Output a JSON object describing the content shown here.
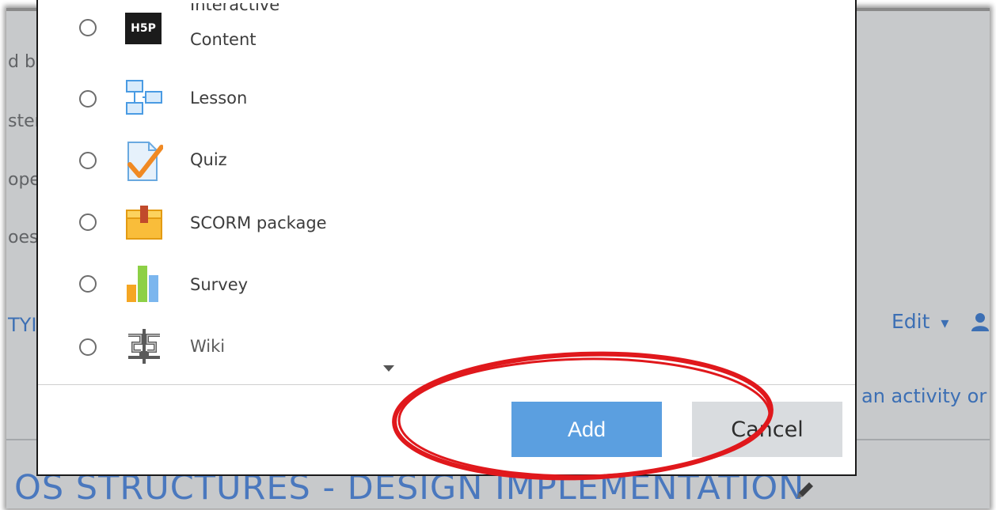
{
  "background": {
    "left_fragments": [
      "d b",
      "ster",
      "ope",
      "oes",
      "TYI"
    ],
    "edit_label": "Edit",
    "caret": "▾",
    "activity_text": "an activity or",
    "section_heading": "OS STRUCTURES - DESIGN IMPLEMENTATION"
  },
  "modal": {
    "options": [
      {
        "label_line1": "Interactive",
        "label_line2": "Content",
        "icon": "h5p-icon"
      },
      {
        "label": "Lesson",
        "icon": "lesson-icon"
      },
      {
        "label": "Quiz",
        "icon": "quiz-icon"
      },
      {
        "label": "SCORM package",
        "icon": "scorm-package-icon"
      },
      {
        "label": "Survey",
        "icon": "survey-icon"
      },
      {
        "label": "Wiki",
        "icon": "wiki-icon"
      }
    ],
    "add_label": "Add",
    "cancel_label": "Cancel",
    "h5p_text": "H5P"
  },
  "colors": {
    "add_button": "#5b9fe0",
    "cancel_button": "#d9dcdf",
    "highlight_ellipse": "#e0181c",
    "link": "#3c6fb4"
  }
}
